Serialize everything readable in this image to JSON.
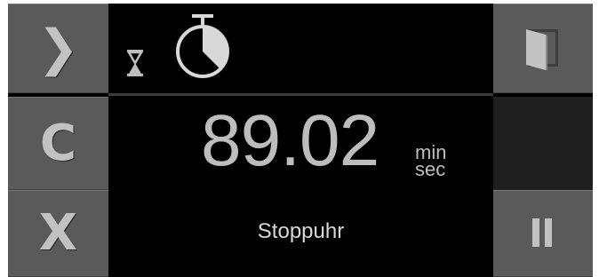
{
  "buttons": {
    "forward": {
      "glyph": "❯",
      "icon": "chevron-right-icon"
    },
    "clear": {
      "glyph": "C",
      "icon": "clear-icon"
    },
    "close": {
      "glyph": "X",
      "icon": "close-icon"
    },
    "exit": {
      "icon": "exit-door-icon"
    },
    "pause": {
      "icon": "pause-icon"
    }
  },
  "status": {
    "timer_icon": "hourglass-icon",
    "mode_icon": "stopwatch-icon"
  },
  "display": {
    "time_value": "89.02",
    "unit_min": "min",
    "unit_sec": "sec",
    "mode_label": "Stoppuhr"
  },
  "colors": {
    "background": "#000000",
    "button": "#5a5a5a",
    "glyph": "#c2c2c2",
    "text": "#bdbdbd"
  }
}
